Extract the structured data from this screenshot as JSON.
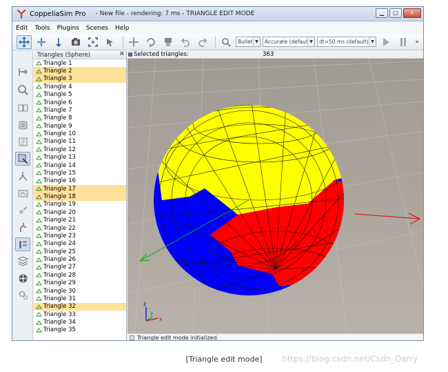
{
  "window": {
    "app_name": "CoppeliaSim Pro",
    "doc_title": "- New file - rendering: 7 ms - TRIANGLE EDIT MODE",
    "buttons": [
      "minimize",
      "maximize",
      "close"
    ]
  },
  "menu": [
    "Edit",
    "Tools",
    "Plugins",
    "Scenes",
    "Help"
  ],
  "toolbar": {
    "engine": "Bullet",
    "accuracy": "Accurate (default)",
    "timestep": "dt=50 ms (default)",
    "more": "»",
    "icons": [
      "camera-pan-icon",
      "camera-rotate-icon",
      "camera-shift-icon",
      "camera-fit-icon",
      "fit-to-view-icon",
      "selection-icon",
      "move-icon",
      "rotate-icon",
      "undo-icon",
      "redo-icon",
      "assemble-icon",
      "play-icon",
      "pause-icon"
    ]
  },
  "sidebar": {
    "icons": [
      "model-browser-icon",
      "scene-hierarchy-icon",
      "collection-icon",
      "script-icon",
      "shape-edit-icon",
      "calculation-icon",
      "path-edit-icon",
      "layers-icon",
      "selection-icon",
      "film-icon",
      "settings-icon"
    ]
  },
  "hierarchy": {
    "title": "Triangles (Sphere)",
    "items": [
      {
        "label": "Triangle 1",
        "selected": false
      },
      {
        "label": "Triangle 2",
        "selected": true
      },
      {
        "label": "Triangle 3",
        "selected": true
      },
      {
        "label": "Triangle 4",
        "selected": false
      },
      {
        "label": "Triangle 5",
        "selected": false
      },
      {
        "label": "Triangle 6",
        "selected": false
      },
      {
        "label": "Triangle 7",
        "selected": false
      },
      {
        "label": "Triangle 8",
        "selected": false
      },
      {
        "label": "Triangle 9",
        "selected": false
      },
      {
        "label": "Triangle 10",
        "selected": false
      },
      {
        "label": "Triangle 11",
        "selected": false
      },
      {
        "label": "Triangle 12",
        "selected": false
      },
      {
        "label": "Triangle 13",
        "selected": false
      },
      {
        "label": "Triangle 14",
        "selected": false
      },
      {
        "label": "Triangle 15",
        "selected": false
      },
      {
        "label": "Triangle 16",
        "selected": false
      },
      {
        "label": "Triangle 17",
        "selected": true
      },
      {
        "label": "Triangle 18",
        "selected": true
      },
      {
        "label": "Triangle 19",
        "selected": false
      },
      {
        "label": "Triangle 20",
        "selected": false
      },
      {
        "label": "Triangle 21",
        "selected": false
      },
      {
        "label": "Triangle 22",
        "selected": false
      },
      {
        "label": "Triangle 23",
        "selected": false
      },
      {
        "label": "Triangle 24",
        "selected": false
      },
      {
        "label": "Triangle 25",
        "selected": false
      },
      {
        "label": "Triangle 26",
        "selected": false
      },
      {
        "label": "Triangle 27",
        "selected": false
      },
      {
        "label": "Triangle 28",
        "selected": false
      },
      {
        "label": "Triangle 29",
        "selected": false
      },
      {
        "label": "Triangle 30",
        "selected": false
      },
      {
        "label": "Triangle 31",
        "selected": false
      },
      {
        "label": "Triangle 32",
        "selected": true
      },
      {
        "label": "Triangle 33",
        "selected": false
      },
      {
        "label": "Triangle 34",
        "selected": false
      },
      {
        "label": "Triangle 35",
        "selected": false
      }
    ]
  },
  "viewport": {
    "selected_label": "Selected triangles:",
    "selected_count": "363",
    "status_text": "Triangle edit mode initialized.",
    "axis_labels": [
      "z",
      "y",
      "x"
    ],
    "colors": {
      "yellow": "#ffff00",
      "red": "#ff0000",
      "blue": "#0000ff",
      "floor": "#a9a39c"
    }
  },
  "caption": "[Triangle edit mode]",
  "watermark": "https://blog.csdn.net/Csdn_Darry"
}
